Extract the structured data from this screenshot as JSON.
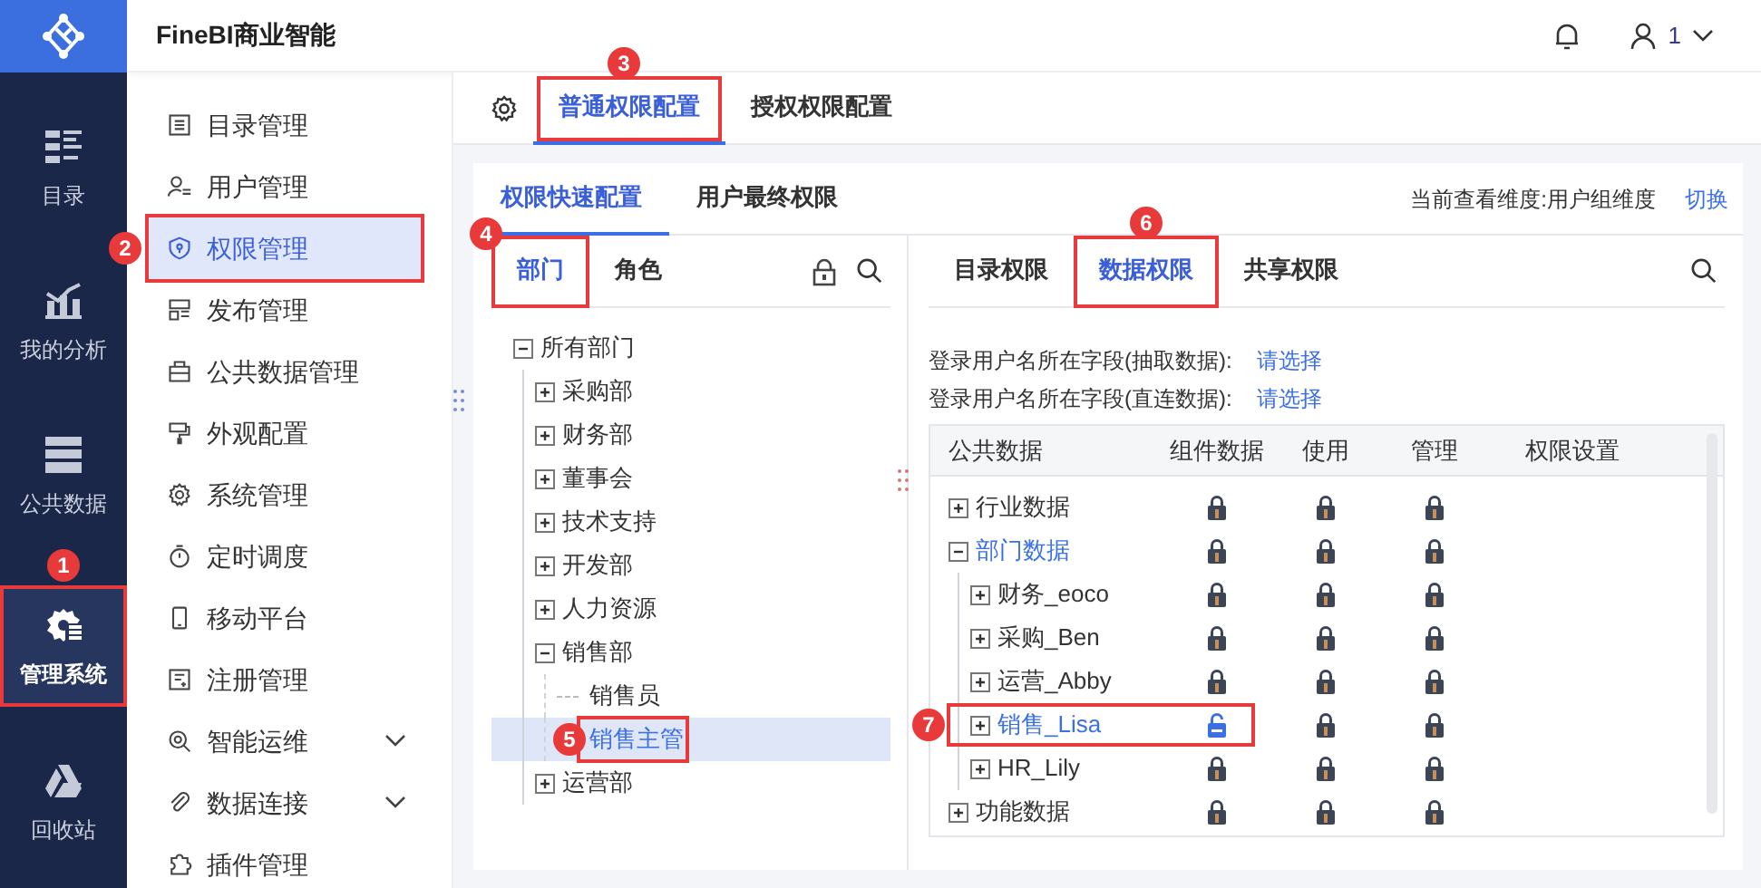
{
  "app_title": "FineBI商业智能",
  "header": {
    "user": "1"
  },
  "rail": [
    {
      "label": "目录",
      "selected": false
    },
    {
      "label": "我的分析",
      "selected": false
    },
    {
      "label": "公共数据",
      "selected": false
    },
    {
      "label": "管理系统",
      "selected": true,
      "callout": "1"
    },
    {
      "label": "回收站",
      "selected": false
    }
  ],
  "menu": [
    {
      "label": "目录管理",
      "selected": false
    },
    {
      "label": "用户管理",
      "selected": false
    },
    {
      "label": "权限管理",
      "selected": true,
      "callout": "2"
    },
    {
      "label": "发布管理",
      "selected": false
    },
    {
      "label": "公共数据管理",
      "selected": false
    },
    {
      "label": "外观配置",
      "selected": false
    },
    {
      "label": "系统管理",
      "selected": false
    },
    {
      "label": "定时调度",
      "selected": false
    },
    {
      "label": "移动平台",
      "selected": false
    },
    {
      "label": "注册管理",
      "selected": false
    },
    {
      "label": "智能运维",
      "selected": false,
      "expanded": false
    },
    {
      "label": "数据连接",
      "selected": false,
      "expanded": false
    },
    {
      "label": "插件管理",
      "selected": false
    }
  ],
  "top_tabs": [
    {
      "label": "普通权限配置",
      "selected": true,
      "callout": "3"
    },
    {
      "label": "授权权限配置",
      "selected": false
    }
  ],
  "sub_tabs": [
    {
      "label": "权限快速配置",
      "selected": true
    },
    {
      "label": "用户最终权限",
      "selected": false
    }
  ],
  "dimension": {
    "text": "当前查看维度:用户组维度",
    "link": "切换"
  },
  "left_tabs": [
    {
      "label": "部门",
      "selected": true,
      "callout": "4"
    },
    {
      "label": "角色",
      "selected": false
    }
  ],
  "dept_tree": [
    {
      "label": "所有部门",
      "expanded": true,
      "selected": false,
      "children": [
        {
          "label": "采购部",
          "expanded": false,
          "selected": false
        },
        {
          "label": "财务部",
          "expanded": false,
          "selected": false
        },
        {
          "label": "董事会",
          "expanded": false,
          "selected": false
        },
        {
          "label": "技术支持",
          "expanded": false,
          "selected": false
        },
        {
          "label": "开发部",
          "expanded": false,
          "selected": false
        },
        {
          "label": "人力资源",
          "expanded": false,
          "selected": false
        },
        {
          "label": "销售部",
          "expanded": true,
          "selected": false,
          "children": [
            {
              "label": "销售员",
              "selected": false
            },
            {
              "label": "销售主管",
              "selected": true,
              "callout": "5"
            }
          ]
        },
        {
          "label": "运营部",
          "expanded": false,
          "selected": false
        }
      ]
    }
  ],
  "right_tabs": [
    {
      "label": "目录权限",
      "selected": false
    },
    {
      "label": "数据权限",
      "selected": true,
      "callout": "6"
    },
    {
      "label": "共享权限",
      "selected": false
    }
  ],
  "fields": [
    {
      "label": "登录用户名所在字段(抽取数据):",
      "link": "请选择"
    },
    {
      "label": "登录用户名所在字段(直连数据):",
      "link": "请选择"
    }
  ],
  "table": {
    "columns": [
      "公共数据",
      "组件数据",
      "使用",
      "管理",
      "权限设置"
    ],
    "rows": [
      {
        "label": "行业数据",
        "expanded": false,
        "highlighted": false,
        "locked": [
          true,
          true,
          true
        ]
      },
      {
        "label": "部门数据",
        "expanded": true,
        "highlighted": true,
        "locked": [
          true,
          true,
          true
        ],
        "children": [
          {
            "label": "财务_eoco",
            "expanded": false,
            "highlighted": false,
            "locked": [
              true,
              true,
              true
            ]
          },
          {
            "label": "采购_Ben",
            "expanded": false,
            "highlighted": false,
            "locked": [
              true,
              true,
              true
            ]
          },
          {
            "label": "运营_Abby",
            "expanded": false,
            "highlighted": false,
            "locked": [
              true,
              true,
              true
            ]
          },
          {
            "label": "销售_Lisa",
            "expanded": false,
            "highlighted": true,
            "locked": [
              false,
              true,
              true
            ],
            "callout": "7"
          },
          {
            "label": "HR_Lily",
            "expanded": false,
            "highlighted": false,
            "locked": [
              true,
              true,
              true
            ]
          }
        ]
      },
      {
        "label": "功能数据",
        "expanded": false,
        "highlighted": false,
        "locked": [
          true,
          true,
          true
        ]
      }
    ]
  }
}
